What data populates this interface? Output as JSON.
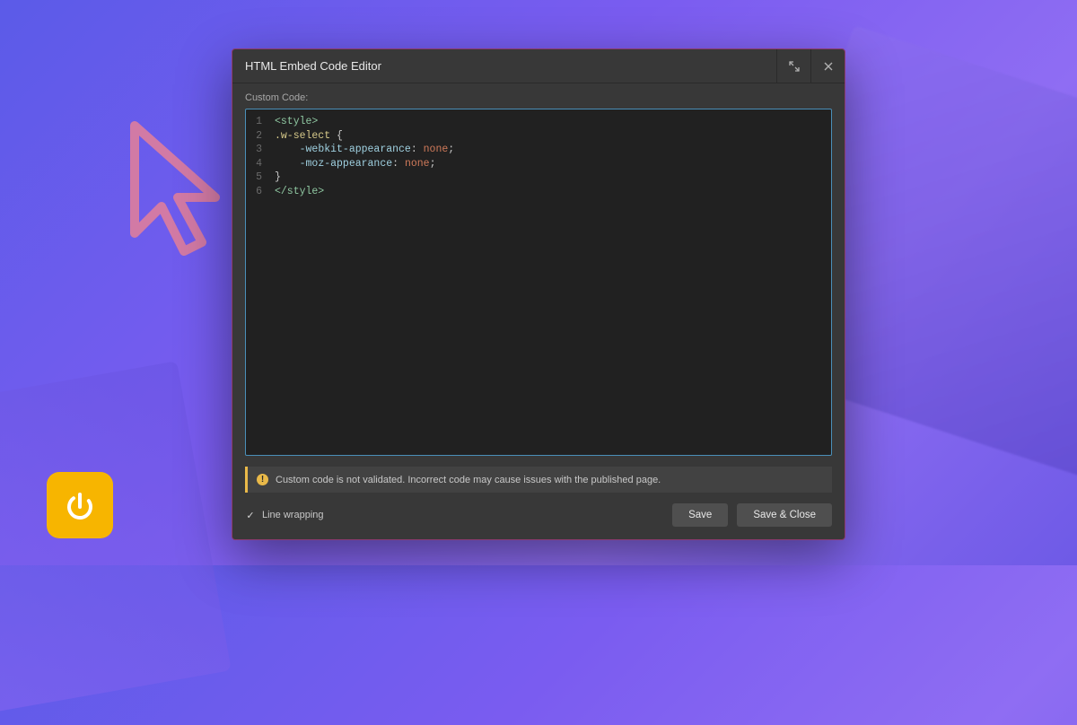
{
  "modal": {
    "title": "HTML Embed Code Editor",
    "section_label": "Custom Code:",
    "code": {
      "line_numbers": [
        "1",
        "2",
        "3",
        "4",
        "5",
        "6"
      ],
      "lines": [
        {
          "tokens": [
            {
              "t": "<style>",
              "c": "tag"
            }
          ]
        },
        {
          "tokens": [
            {
              "t": ".w-select",
              "c": "sel"
            },
            {
              "t": " {",
              "c": "punc"
            }
          ]
        },
        {
          "tokens": [
            {
              "t": "    ",
              "c": "punc"
            },
            {
              "t": "-webkit-appearance",
              "c": "prop"
            },
            {
              "t": ": ",
              "c": "punc"
            },
            {
              "t": "none",
              "c": "val"
            },
            {
              "t": ";",
              "c": "punc"
            }
          ]
        },
        {
          "tokens": [
            {
              "t": "    ",
              "c": "punc"
            },
            {
              "t": "-moz-appearance",
              "c": "prop"
            },
            {
              "t": ": ",
              "c": "punc"
            },
            {
              "t": "none",
              "c": "val"
            },
            {
              "t": ";",
              "c": "punc"
            }
          ]
        },
        {
          "tokens": [
            {
              "t": "}",
              "c": "punc"
            }
          ]
        },
        {
          "tokens": [
            {
              "t": "</style>",
              "c": "tag"
            }
          ]
        }
      ]
    },
    "warning": "Custom code is not validated. Incorrect code may cause issues with the published page.",
    "line_wrapping_label": "Line wrapping",
    "line_wrapping_checked": true,
    "buttons": {
      "save": "Save",
      "save_close": "Save & Close"
    }
  },
  "icons": {
    "expand": "expand-icon",
    "close": "close-icon",
    "warning": "warning-icon",
    "power": "power-icon",
    "cursor": "cursor-icon"
  }
}
